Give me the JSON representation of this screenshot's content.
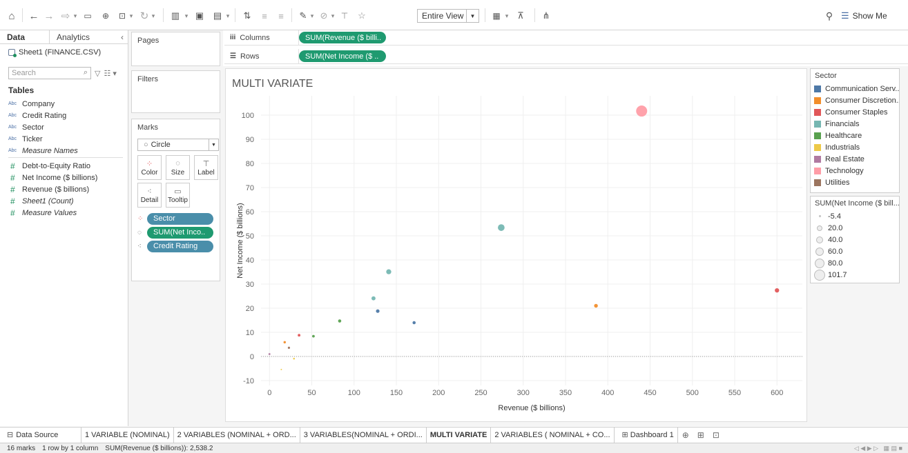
{
  "toolbar": {
    "view_dropdown": "Entire View",
    "show_me": "Show Me"
  },
  "data_pane": {
    "tabs": {
      "data": "Data",
      "analytics": "Analytics"
    },
    "datasource": "Sheet1 (FINANCE.CSV)",
    "search_placeholder": "Search",
    "tables_label": "Tables",
    "dimensions": [
      {
        "type": "Abc",
        "name": "Company"
      },
      {
        "type": "Abc",
        "name": "Credit Rating"
      },
      {
        "type": "Abc",
        "name": "Sector"
      },
      {
        "type": "Abc",
        "name": "Ticker"
      },
      {
        "type": "Abc",
        "name": "Measure Names"
      }
    ],
    "measures": [
      {
        "type": "#",
        "name": "Debt-to-Equity Ratio"
      },
      {
        "type": "#",
        "name": "Net Income ($ billions)"
      },
      {
        "type": "#",
        "name": "Revenue ($ billions)"
      },
      {
        "type": "#",
        "name": "Sheet1 (Count)"
      },
      {
        "type": "#",
        "name": "Measure Values"
      }
    ]
  },
  "shelves": {
    "pages": "Pages",
    "filters": "Filters",
    "marks": "Marks",
    "mark_type": "Circle",
    "buttons": {
      "color": "Color",
      "size": "Size",
      "label": "Label",
      "detail": "Detail",
      "tooltip": "Tooltip"
    },
    "mark_pills": [
      "Sector",
      "SUM(Net Inco..",
      "Credit Rating"
    ],
    "columns_label": "Columns",
    "columns_pill": "SUM(Revenue ($ billi..",
    "rows_label": "Rows",
    "rows_pill": "SUM(Net Income ($ .."
  },
  "colors": {
    "Communication Serv..": "#4e79a7",
    "Consumer Discretion..": "#f28e2b",
    "Consumer Staples": "#e15759",
    "Financials": "#76b7b2",
    "Healthcare": "#59a14f",
    "Industrials": "#edc948",
    "Real Estate": "#b07aa1",
    "Technology": "#ff9da7",
    "Utilities": "#9c755f"
  },
  "legend_sector": {
    "title": "Sector",
    "items": [
      "Communication Serv..",
      "Consumer Discretion..",
      "Consumer Staples",
      "Financials",
      "Healthcare",
      "Industrials",
      "Real Estate",
      "Technology",
      "Utilities"
    ]
  },
  "legend_size": {
    "title": "SUM(Net Income ($ bill...",
    "items": [
      "-5.4",
      "20.0",
      "40.0",
      "60.0",
      "80.0",
      "101.7"
    ]
  },
  "chart_data": {
    "type": "scatter",
    "title": "MULTI VARIATE",
    "xlabel": "Revenue ($ billions)",
    "ylabel": "Net Income ($ billions)",
    "xlim": [
      -10,
      630
    ],
    "ylim": [
      -12,
      108
    ],
    "xticks": [
      0,
      50,
      100,
      150,
      200,
      250,
      300,
      350,
      400,
      450,
      500,
      550,
      600
    ],
    "yticks": [
      -10,
      0,
      10,
      20,
      30,
      40,
      50,
      60,
      70,
      80,
      90,
      100
    ],
    "grid": true,
    "points": [
      {
        "x": 440,
        "y": 101.7,
        "sector": "Technology"
      },
      {
        "x": 274,
        "y": 53.4,
        "sector": "Financials"
      },
      {
        "x": 141,
        "y": 35.1,
        "sector": "Financials"
      },
      {
        "x": 123,
        "y": 24.1,
        "sector": "Financials"
      },
      {
        "x": 128,
        "y": 18.8,
        "sector": "Communication Serv.."
      },
      {
        "x": 171,
        "y": 14.0,
        "sector": "Communication Serv.."
      },
      {
        "x": 83,
        "y": 14.7,
        "sector": "Healthcare"
      },
      {
        "x": 52,
        "y": 8.4,
        "sector": "Healthcare"
      },
      {
        "x": 35,
        "y": 8.8,
        "sector": "Consumer Staples"
      },
      {
        "x": 600,
        "y": 27.4,
        "sector": "Consumer Staples"
      },
      {
        "x": 386,
        "y": 21.0,
        "sector": "Consumer Discretion.."
      },
      {
        "x": 18,
        "y": 5.9,
        "sector": "Consumer Discretion.."
      },
      {
        "x": 23,
        "y": 3.6,
        "sector": "Utilities"
      },
      {
        "x": 0,
        "y": 1.0,
        "sector": "Real Estate"
      },
      {
        "x": 29,
        "y": -0.9,
        "sector": "Industrials"
      },
      {
        "x": 14,
        "y": -5.4,
        "sector": "Industrials"
      }
    ]
  },
  "sheet_tabs": {
    "data_source": "Data Source",
    "tabs": [
      "1 VARIABLE (NOMINAL)",
      "2 VARIABLES (NOMINAL + ORD...",
      "3 VARIABLES(NOMINAL + ORDI...",
      "MULTI VARIATE",
      "2 VARIABLES ( NOMINAL + CO...",
      "Dashboard 1"
    ],
    "active_index": 3
  },
  "status": {
    "marks": "16 marks",
    "layout": "1 row by 1 column",
    "sum": "SUM(Revenue ($ billions)): 2,538.2"
  }
}
